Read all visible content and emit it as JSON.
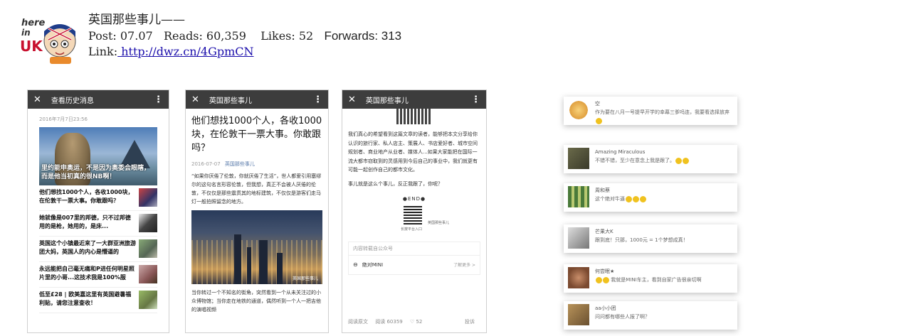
{
  "header": {
    "title": "英国那些事儿——",
    "post_label": "Post: 07.07",
    "reads_label": "Reads: 60,359",
    "likes_label": "Likes: 52",
    "forwards_label": "Forwards: 313",
    "link_prefix": "Link:",
    "link_url": " http://dwz.cn/4GpmCN",
    "logo_text_1": "here",
    "logo_text_2": "in",
    "logo_text_3": "UK"
  },
  "phone1": {
    "bar_title": "查看历史消息",
    "date": "2016年7月7日23:56",
    "hero_caption": "里约能申奥运，不是因为奥委会眼瞎，而是他当初真的很NB啊！",
    "items": [
      {
        "text": "他们想找1000个人，各收1000块，在伦敦干一票大事。你敢跟吗？"
      },
      {
        "text": "她就像是007里的邦德，只不过邦德用的是枪，她用的，是床..."
      },
      {
        "text": "英国这个小镇最近来了一大群亚洲旅游团大妈，英国人的内心是懵逼的"
      },
      {
        "text": "永远能把自己毫无痛和P进任何明星照片里的小哥...这技术我是100%服"
      },
      {
        "text": "低至£28 | 欧美嘉这里有英国避暑福利贴，请您注意查收！"
      }
    ]
  },
  "phone2": {
    "bar_title": "英国那些事儿",
    "headline": "他们想找1000个人，各收1000块，在伦敦干一票大事。你敢跟吗？",
    "date": "2016-07-07",
    "account": "英国那些事儿",
    "body": "“如果你厌倦了伦敦，你就厌倦了生活”，世人都爱引用塞缪尔的这句名言形容伦敦，但我想，真正不会被人厌倦的伦敦，不仅仅是那些震贯其的地标建筑，不仅仅是游客们走马灯一般拍照留念的地方。",
    "image_watermark": "英国那些事儿",
    "body2": "当你转过一个不知名的街角，突然看到一个从未关注过的小众博物馆；当你走在地铁的通道，偶然听到一个人一把吉他的演唱视频"
  },
  "phone3": {
    "bar_title": "英国那些事儿",
    "body": "我们真心的希望看到这篇文章的读者，能够把本文分享给你认识的旅行家、私人店主、策展人、书店爱好者、城市空间规划者、商业地产从业者、媒体人...如果大家能把在国际一流大都市窃取到的灵感用到今后自己的事业中，我们就更有可能一起创作自己的都市文化。",
    "line2": "事儿就是这么个事儿，反正我跟了，你呢？",
    "end": "●END●",
    "qr_caption_left": "长按平台入口",
    "qr_caption_right": "英国那些事儿",
    "card_header": "内容转载自公众号",
    "card_name": "绝对MINI",
    "card_more": "了解更多 >",
    "foot_read": "阅读原文",
    "foot_reads": "阅读 60359",
    "foot_likes": "♡ 52",
    "foot_report": "投诉"
  },
  "comments": [
    {
      "name": "空",
      "text": "作为要在八月一号提早开学的幸幕三爹吗连，我要看选择放弃"
    },
    {
      "name": "Amazing Miraculous",
      "text": "不错不错，至少在意念上我是跟了。"
    },
    {
      "name": "周和蔡",
      "text": "这个绝对牛逼"
    },
    {
      "name": "芒果大K",
      "text": "跟到底！只那，1000元 = 1个梦想成真！"
    },
    {
      "name": "何尝眠★",
      "text": "我就是MINI车主，看到自家广告很亲切啊"
    },
    {
      "name": "aa小小团",
      "text": "问问都有哪些人报了啊？"
    }
  ]
}
